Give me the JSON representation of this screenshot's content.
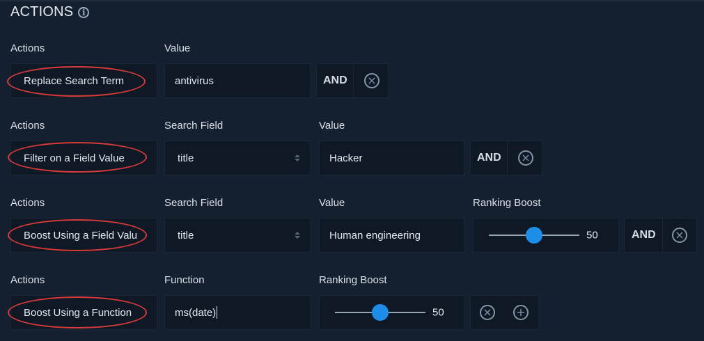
{
  "header": {
    "title": "ACTIONS",
    "info_glyph": "i"
  },
  "colors": {
    "background": "#14202f",
    "field": "#0f1926",
    "annotation_oval": "#d93a3a",
    "slider_thumb": "#1e8ee8"
  },
  "rows": [
    {
      "labels": {
        "actions": "Actions",
        "value": "Value"
      },
      "action": "Replace Search Term",
      "value": "antivirus",
      "operator": "AND",
      "remove_icon": "close-circle-icon"
    },
    {
      "labels": {
        "actions": "Actions",
        "search_field": "Search Field",
        "value": "Value"
      },
      "action": "Filter on a Field Value",
      "search_field": "title",
      "value": "Hacker",
      "operator": "AND",
      "remove_icon": "close-circle-icon"
    },
    {
      "labels": {
        "actions": "Actions",
        "search_field": "Search Field",
        "value": "Value",
        "ranking_boost": "Ranking Boost"
      },
      "action": "Boost Using a Field Valu",
      "search_field": "title",
      "value": "Human engineering",
      "ranking_boost": "50",
      "ranking_boost_fraction": 0.5,
      "operator": "AND",
      "remove_icon": "close-circle-icon"
    },
    {
      "labels": {
        "actions": "Actions",
        "function": "Function",
        "ranking_boost": "Ranking Boost"
      },
      "action": "Boost Using a Function",
      "function": "ms(date)",
      "ranking_boost": "50",
      "ranking_boost_fraction": 0.5,
      "remove_icon": "close-circle-icon",
      "add_icon": "plus-circle-icon"
    }
  ]
}
